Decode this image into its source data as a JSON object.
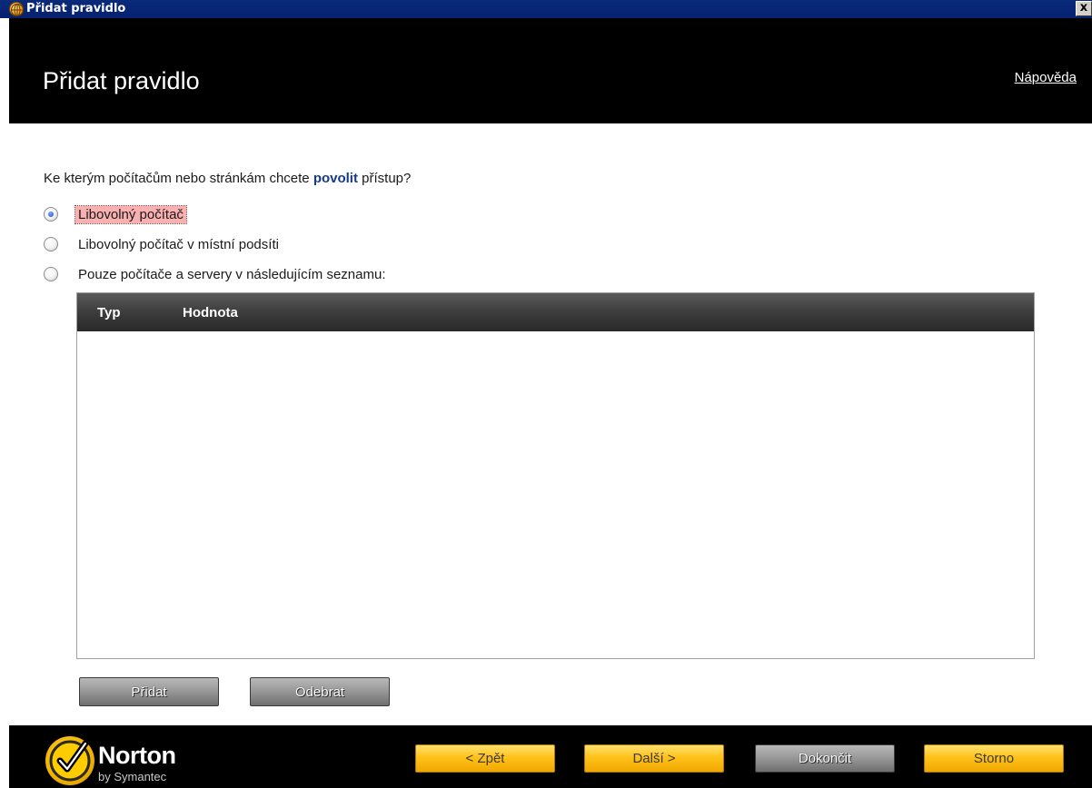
{
  "window": {
    "title": "Přidat pravidlo",
    "close_glyph": "x"
  },
  "header": {
    "title": "Přidat pravidlo",
    "help_link": "Nápověda"
  },
  "question": {
    "before": "Ke kterým počítačům nebo stránkám chcete ",
    "highlight": "povolit",
    "after": " přístup?"
  },
  "options": [
    {
      "label": "Libovolný počítač",
      "selected": true
    },
    {
      "label": "Libovolný počítač v místní podsíti",
      "selected": false
    },
    {
      "label": "Pouze počítače a servery v následujícím seznamu:",
      "selected": false
    }
  ],
  "table": {
    "columns": [
      "Typ",
      "Hodnota"
    ],
    "rows": []
  },
  "list_buttons": {
    "add": "Přidat",
    "remove": "Odebrat"
  },
  "footer": {
    "brand": "Norton",
    "brand_sub": "by Symantec",
    "back": "< Zpět",
    "next": "Další >",
    "finish": "Dokončit",
    "cancel": "Storno"
  },
  "colors": {
    "accent_yellow": "#ffc21a",
    "question_highlight": "#143a8a",
    "focus_highlight": "#f8b0b0",
    "titlebar": "#0a2a7a"
  },
  "icons": {
    "window_icon": "globe-icon",
    "brand_icon": "norton-checkmark-icon"
  }
}
